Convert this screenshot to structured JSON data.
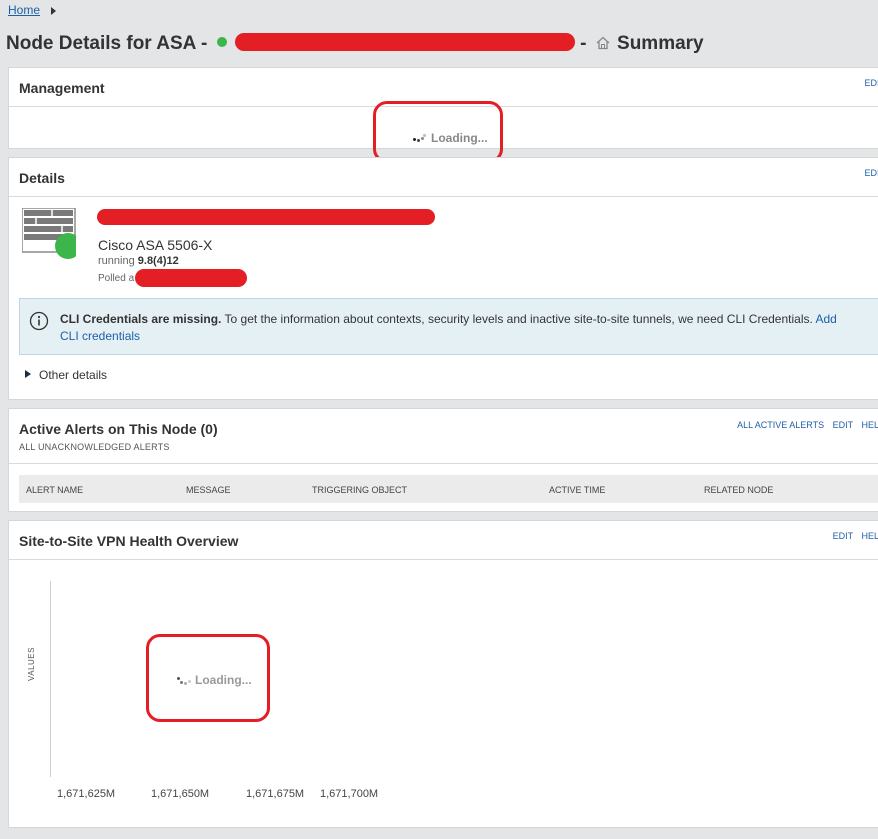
{
  "breadcrumb": {
    "home": "Home"
  },
  "page": {
    "title_prefix": "Node Details for ASA -",
    "title_separator": "-",
    "title_suffix": "Summary"
  },
  "management": {
    "title": "Management",
    "edit": "EDIT",
    "loading": "Loading..."
  },
  "details": {
    "title": "Details",
    "edit": "EDIT",
    "model": "Cisco ASA 5506-X",
    "running_label": "running",
    "version": "9.8(4)12",
    "polled_prefix": "Polled a",
    "info_bold": "CLI Credentials are missing.",
    "info_text": " To get the information about contexts, security levels and inactive site-to-site tunnels, we need CLI Credentials. ",
    "info_link": "Add CLI credentials",
    "other_details": "Other details"
  },
  "alerts": {
    "title": "Active Alerts on This Node (0)",
    "subtitle": "ALL UNACKNOWLEDGED ALERTS",
    "links": [
      "ALL ACTIVE ALERTS",
      "EDIT",
      "HELP"
    ],
    "columns": [
      "ALERT NAME",
      "MESSAGE",
      "TRIGGERING OBJECT",
      "ACTIVE TIME",
      "RELATED NODE"
    ]
  },
  "vpn": {
    "title": "Site-to-Site VPN Health Overview",
    "links": [
      "EDIT",
      "HELP"
    ],
    "ylabel": "VALUES",
    "loading": "Loading...",
    "xticks": [
      "1,671,625M",
      "1,671,650M",
      "1,671,675M",
      "1,671,700M"
    ]
  },
  "colors": {
    "accent": "#1e5fa8",
    "status_up": "#3cb54a",
    "redaction": "#e31e24",
    "info_bg": "#e5f0f5"
  }
}
